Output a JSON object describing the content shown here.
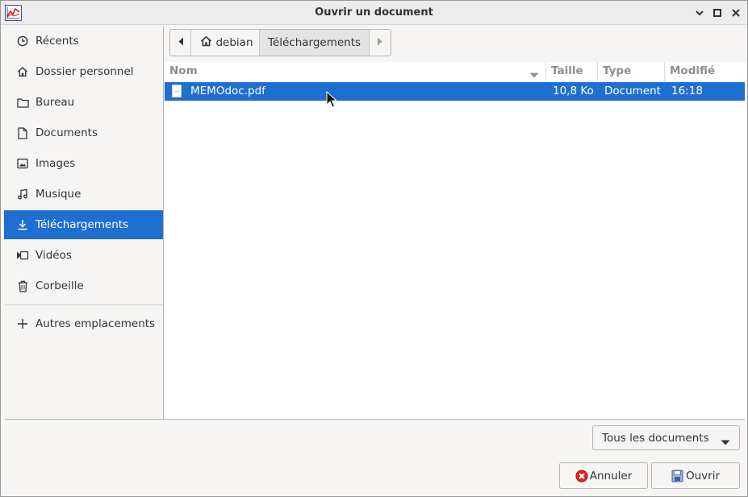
{
  "window": {
    "title": "Ouvrir un document",
    "app_icon": "chart-app-icon",
    "controls": [
      "minimize-icon",
      "maximize-icon",
      "close-icon"
    ]
  },
  "sidebar": {
    "items": [
      {
        "label": "Récents",
        "icon": "clock-icon"
      },
      {
        "label": "Dossier personnel",
        "icon": "home-icon"
      },
      {
        "label": "Bureau",
        "icon": "folder-icon"
      },
      {
        "label": "Documents",
        "icon": "document-icon"
      },
      {
        "label": "Images",
        "icon": "image-icon"
      },
      {
        "label": "Musique",
        "icon": "music-icon"
      },
      {
        "label": "Téléchargements",
        "icon": "download-icon",
        "selected": true
      },
      {
        "label": "Vidéos",
        "icon": "video-icon"
      },
      {
        "label": "Corbeille",
        "icon": "trash-icon"
      }
    ],
    "other_locations": {
      "label": "Autres emplacements",
      "icon": "plus-icon"
    }
  },
  "pathbar": {
    "home_label": "debian",
    "current_label": "Téléchargements"
  },
  "filelist": {
    "columns": {
      "name": "Nom",
      "size": "Taille",
      "type": "Type",
      "modified": "Modifié"
    },
    "files": [
      {
        "name": "MEMOdoc.pdf",
        "size": "10,8 Ko",
        "type": "Document",
        "modified": "16:18",
        "selected": true
      }
    ]
  },
  "filter": {
    "selected": "Tous les documents"
  },
  "buttons": {
    "cancel": "Annuler",
    "open": "Ouvrir"
  },
  "colors": {
    "selection": "#1f6fd0",
    "background": "#f6f5f4"
  }
}
